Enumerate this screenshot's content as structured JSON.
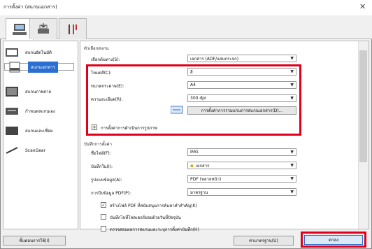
{
  "window": {
    "title": "การตั้งค่า (สแกนเอกสาร)",
    "close_glyph": "✕"
  },
  "tabs": [
    {
      "name": "scan-tab",
      "icon": "scanner-computer-icon"
    },
    {
      "name": "scanner-tab",
      "icon": "scanner-icon"
    },
    {
      "name": "tools-tab",
      "icon": "tools-icon"
    }
  ],
  "sidebar": {
    "items": [
      {
        "label": "สแกนอัตโนมัติ",
        "icon": "auto-scan-icon"
      },
      {
        "label": "สแกนเอกสาร",
        "icon": "pdf-document-icon",
        "selected": true
      },
      {
        "label": "สแกนภาพถ่าย",
        "icon": "photo-icon"
      },
      {
        "label": "กำหนดสแกนเอง",
        "icon": "custom-scan-icon"
      },
      {
        "label": "สแกนและเชื่อม",
        "icon": "stitch-icon"
      },
      {
        "label": "ScanGear",
        "icon": "scangear-icon"
      }
    ]
  },
  "scan_options": {
    "group_label": "ตัวเลือกสแกน",
    "source_label": "เลือกต้นทาง(S):",
    "source_value": "เอกสาร (ADF/แผ่นกระจก)",
    "color_label": "โหมดสี(C):",
    "color_value": "สี",
    "size_label": "ขนาดกระดาษ(E):",
    "size_value": "A4",
    "res_label": "ความละเอียด(R):",
    "res_value": "300 dpi",
    "settings_button": "การตั้งค่าการรวมแกนการสแกนเอกสาร(D)...",
    "image_proc": "การตั้งค่าการดำเนินการรูปภาพ"
  },
  "save_settings": {
    "group_label": "บันทึกการตั้งค่า",
    "filename_label": "ชื่อไฟล์(F):",
    "filename_value": "IMG",
    "savein_label": "บันทึกใน(I):",
    "savein_value": "เอกสาร",
    "format_label": "รูปแบบข้อมูล(A):",
    "format_value": "PDF (หลายหน้า)",
    "pdf_label": "การบีบข้อมูล PDF(P):",
    "pdf_value": "มาตรฐาน",
    "check1": "สร้างไฟล์ PDF ที่สนับสนุนการค้นหาคำสำคัญ(K)",
    "check2": "บันทึกไปที่โฟลเดอร์ย่อยด้วยวันที่ปัจจุบัน",
    "check3": "ตรวจสอบผลการสแกนและระบุการตั้งค่าบันทึก(H)"
  },
  "footer": {
    "instructions": "ขั้นตอนการใช้(I)",
    "defaults": "ค่ามาตรฐาน(U)",
    "ok": "ตกลง"
  },
  "colors": {
    "highlight": "#e0001b",
    "selection": "#2b6fd1"
  }
}
